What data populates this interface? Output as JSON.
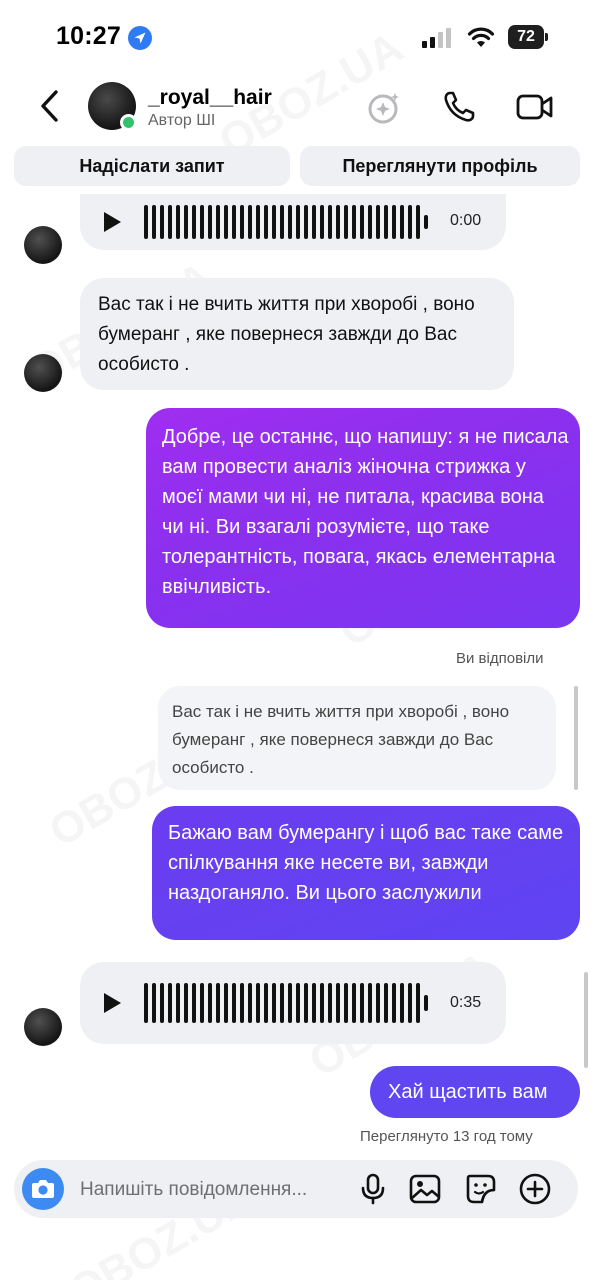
{
  "status_bar": {
    "time": "10:27",
    "battery": "72"
  },
  "header": {
    "contact_name": "_royal__hair",
    "contact_subtitle": "Автор ШІ"
  },
  "actions": {
    "send_request": "Надіслати запит",
    "view_profile": "Переглянути профіль"
  },
  "messages": {
    "voice_1": {
      "duration": "0:00"
    },
    "incoming_1": "Вас так і не вчить життя при хворобі , воно бумеранг , яке повернеся завжди до Вас особисто .",
    "outgoing_1": "Добре, це останнє, що напишу: я не писала вам провести аналіз жіночна стрижка у моєї мами чи ні, не питала, красива вона чи ні. Ви взагалі розумієте, що таке толерантність, повага, якась елементарна ввічливість.",
    "reply_label": "Ви відповіли",
    "quoted": "Вас так і не вчить життя при хворобі , воно бумеранг , яке повернеся завжди до Вас особисто .",
    "outgoing_2": "Бажаю вам бумерангу і щоб вас таке саме спілкування яке несете ви, завжди наздоганяло. Ви цього заслужили",
    "voice_2": {
      "duration": "0:35"
    },
    "outgoing_3": "Хай щастить вам",
    "seen_status": "Переглянуто 13 год тому"
  },
  "composer": {
    "placeholder": "Напишіть повідомлення..."
  },
  "watermark": "OBOZ.UA",
  "colors": {
    "bubble_in": "#eef0f4",
    "bubble_out_purple": "#9a30ef",
    "bubble_out_violet": "#5f46f0",
    "online": "#31c26b",
    "camera": "#3d8bf2"
  }
}
